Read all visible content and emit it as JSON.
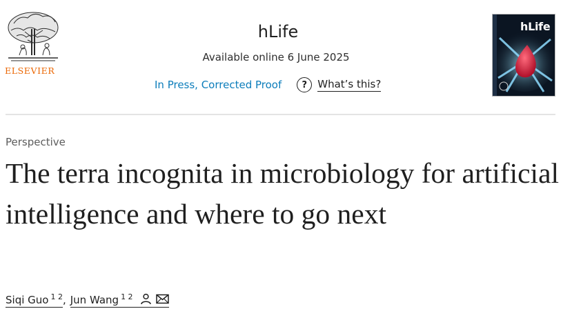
{
  "header": {
    "publisher": "ELSEVIER",
    "journal_title": "hLife",
    "availability": "Available online 6 June 2025",
    "status_link": "In Press, Corrected Proof",
    "whats_this": "What’s this?",
    "help_icon": "question-circle-icon",
    "cover": {
      "title": "hLife"
    }
  },
  "article": {
    "type": "Perspective",
    "title": "The terra incognita in microbiology for artificial intelligence and where to go next"
  },
  "authors": [
    {
      "name": "Siqi Guo",
      "affiliations": "1 2",
      "separator": ","
    },
    {
      "name": "Jun Wang",
      "affiliations": "1 2",
      "icons": [
        "person-icon",
        "envelope-icon"
      ]
    }
  ],
  "colors": {
    "publisher_orange": "#eb6500",
    "link_blue": "#0c7dbb",
    "text": "#1f1f1f",
    "cover_background": "#0b1522",
    "cover_accent_red": "#e0213a"
  }
}
